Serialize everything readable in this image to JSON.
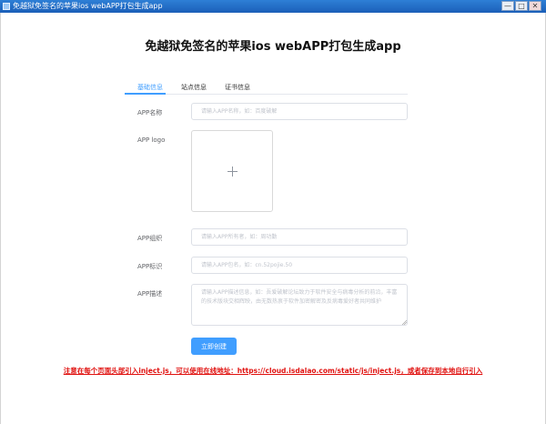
{
  "window": {
    "title": "免越狱免签名的苹果ios webAPP打包生成app",
    "min_label": "—",
    "max_label": "□",
    "close_label": "✕"
  },
  "page": {
    "title": "免越狱免签名的苹果ios webAPP打包生成app"
  },
  "tabs": [
    {
      "label": "基础信息",
      "active": true
    },
    {
      "label": "站点信息",
      "active": false
    },
    {
      "label": "证书信息",
      "active": false
    }
  ],
  "form": {
    "name_label": "APP名称",
    "name_placeholder": "请输入APP名称，如：百度破解",
    "logo_label": "APP logo",
    "org_label": "APP组织",
    "org_placeholder": "请输入APP所有者，如：周功勤",
    "id_label": "APP标识",
    "id_placeholder": "请输入APP包名，如：cn.52pojie.50",
    "desc_label": "APP描述",
    "desc_placeholder": "请输入APP描述信息，如：吾爱破解论坛致力于软件安全与病毒分析的前沿，丰富的技术版块交相辉映，由无数热衷于软件加密解密及反病毒爱好者共同维护",
    "submit_label": "立即创建"
  },
  "notice": "注意在每个页面头部引入inject.js，可以使用在线地址：https://cloud.isdalao.com/static/js/inject.js，或者保存到本地自行引入",
  "colors": {
    "accent": "#409eff",
    "notice": "#e0110f",
    "titlebar": "#1b5fb8"
  }
}
